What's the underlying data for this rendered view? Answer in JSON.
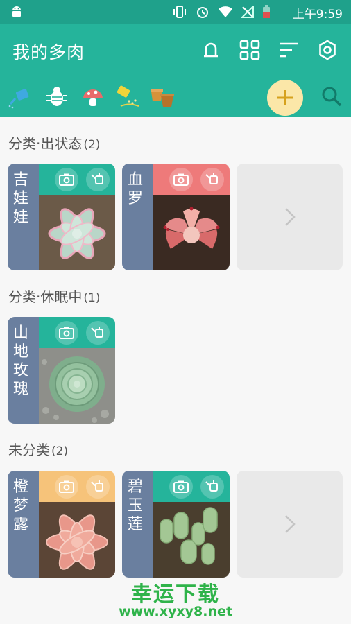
{
  "status_bar": {
    "time": "上午9:59"
  },
  "app_bar": {
    "title": "我的多肉"
  },
  "sections": [
    {
      "title": "分类·出状态",
      "count": "(2)"
    },
    {
      "title": "分类·休眠中",
      "count": "(1)"
    },
    {
      "title": "未分类",
      "count": "(2)"
    }
  ],
  "cards": [
    {
      "name": "吉娃娃",
      "header_color": "#25b49b"
    },
    {
      "name": "血罗",
      "header_color": "#ee7a7a"
    },
    {
      "name": "山地玫瑰",
      "header_color": "#25b49b"
    },
    {
      "name": "橙梦露",
      "header_color": "#f6c37a"
    },
    {
      "name": "碧玉莲",
      "header_color": "#25b49b"
    }
  ],
  "watermark": {
    "line1": "幸运下载",
    "line2": "www.xyxy8.net"
  },
  "colors": {
    "primary": "#25b49b",
    "status": "#1fa18b",
    "namebar": "#6a7f9f",
    "accent": "#fbe7a8"
  }
}
